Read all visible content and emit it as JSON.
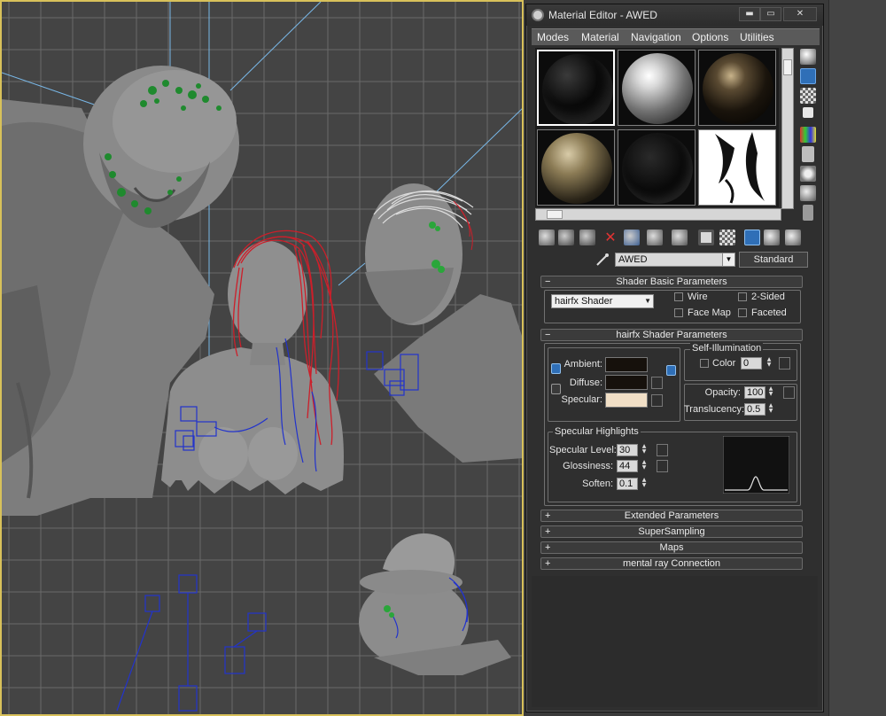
{
  "window": {
    "title": "Material Editor - AWED",
    "minimize_label": "▬",
    "maximize_label": "▭",
    "close_label": "✕"
  },
  "menu": [
    "Modes",
    "Material",
    "Navigation",
    "Options",
    "Utilities"
  ],
  "material": {
    "name": "AWED",
    "type": "Standard"
  },
  "sample_slots": {
    "count": 6,
    "active_index": 0
  },
  "rollouts": {
    "shader_basic": {
      "title": "Shader Basic Parameters",
      "sign": "−",
      "shader": "hairfx Shader",
      "wire": "Wire",
      "two_sided": "2-Sided",
      "face_map": "Face Map",
      "faceted": "Faceted"
    },
    "hairfx": {
      "title": "hairfx Shader Parameters",
      "sign": "−",
      "ambient": "Ambient:",
      "diffuse": "Diffuse:",
      "specular": "Specular:",
      "self_illum_title": "Self-Illumination",
      "color_label": "Color",
      "color_value": "0",
      "opacity_label": "Opacity:",
      "opacity_value": "100",
      "translucency_label": "Translucency:",
      "translucency_value": "0.5",
      "ambient_color": "#16110c",
      "diffuse_color": "#16110c",
      "specular_color": "#f1dfc6"
    },
    "specular_highlights": {
      "title": "Specular Highlights",
      "spec_level_label": "Specular Level:",
      "spec_level_value": "30",
      "glossiness_label": "Glossiness:",
      "glossiness_value": "44",
      "soften_label": "Soften:",
      "soften_value": "0.1"
    },
    "collapsed": [
      {
        "sign": "+",
        "title": "Extended Parameters"
      },
      {
        "sign": "+",
        "title": "SuperSampling"
      },
      {
        "sign": "+",
        "title": "Maps"
      },
      {
        "sign": "+",
        "title": "mental ray Connection"
      }
    ]
  },
  "icons": {
    "side_toolbar": [
      "sample-type-icon",
      "backlight-icon",
      "background-icon",
      "uv-tiling-icon",
      "video-color-check-icon",
      "make-preview-icon",
      "options-icon",
      "select-by-material-icon",
      "material-id-navigator-icon"
    ],
    "bottom_toolbar": [
      "get-material-icon",
      "put-to-scene-icon",
      "assign-to-selection-icon",
      "reset-map-icon",
      "make-unique-icon",
      "put-to-library-icon",
      "material-id-channel-icon",
      "show-map-in-viewport-icon",
      "show-end-result-icon",
      "go-to-parent-icon",
      "go-forward-to-sibling-icon",
      "go-sibling-icon"
    ]
  },
  "colors": {
    "viewport_border": "#d8c15a",
    "viewport_bg": "#444444",
    "grid_line": "#6a6a6a",
    "hair_red": "#cc1f2a",
    "hair_blue": "#2233cc",
    "hair_green": "#2aa63a"
  }
}
